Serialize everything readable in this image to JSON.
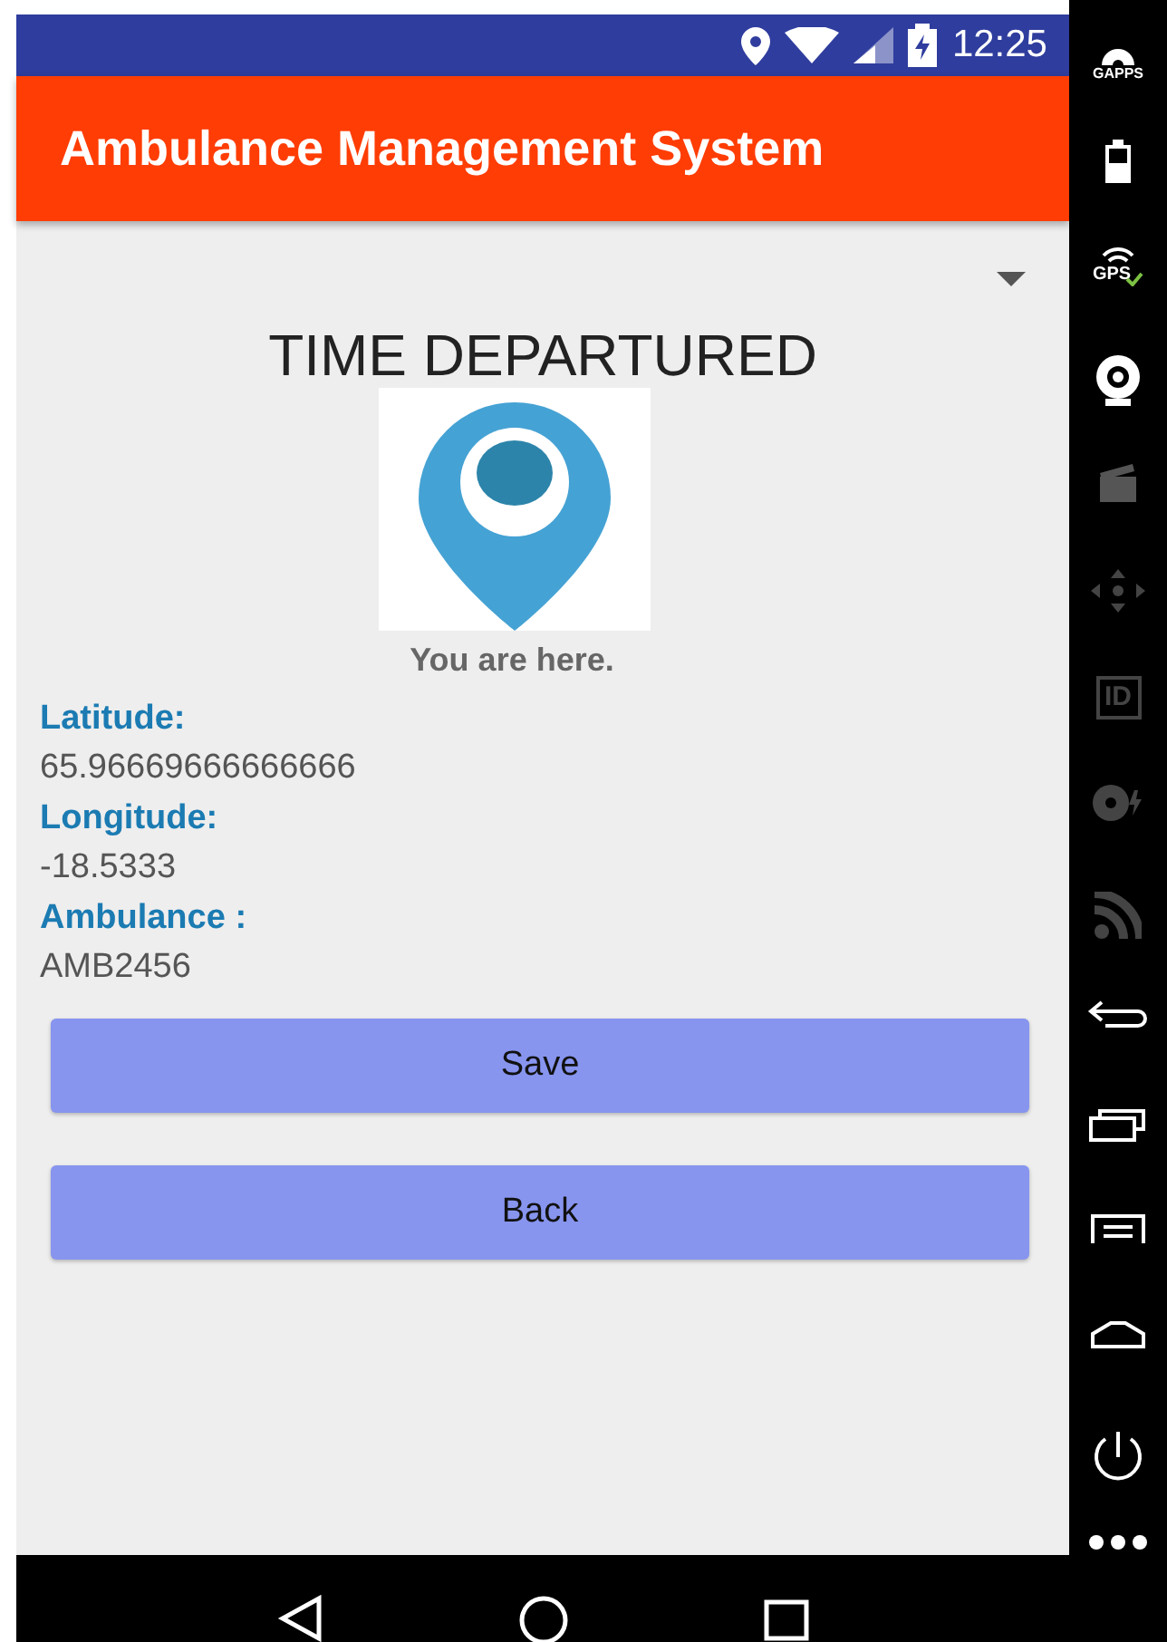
{
  "status_bar": {
    "time": "12:25"
  },
  "app_bar": {
    "title": "Ambulance Management System"
  },
  "screen": {
    "heading": "TIME DEPARTURED",
    "picture_caption": "You are here.",
    "fields": [
      {
        "label": "Latitude:",
        "value": "65.96669666666666"
      },
      {
        "label": "Longitude:",
        "value": "-18.5333"
      },
      {
        "label": "Ambulance :",
        "value": "AMB2456"
      }
    ],
    "buttons": [
      "Save",
      "Back"
    ]
  },
  "emulator_sidebar": [
    {
      "kind": "gapps",
      "label": "GAPPS"
    },
    {
      "kind": "battery"
    },
    {
      "kind": "gps",
      "label": "GPS"
    },
    {
      "kind": "camera"
    },
    {
      "kind": "clapper"
    },
    {
      "kind": "dpad"
    },
    {
      "kind": "id",
      "label": "ID"
    },
    {
      "kind": "disc"
    },
    {
      "kind": "rss"
    },
    {
      "kind": "back"
    },
    {
      "kind": "recents"
    },
    {
      "kind": "menu"
    },
    {
      "kind": "home"
    },
    {
      "kind": "power"
    },
    {
      "kind": "more"
    }
  ]
}
